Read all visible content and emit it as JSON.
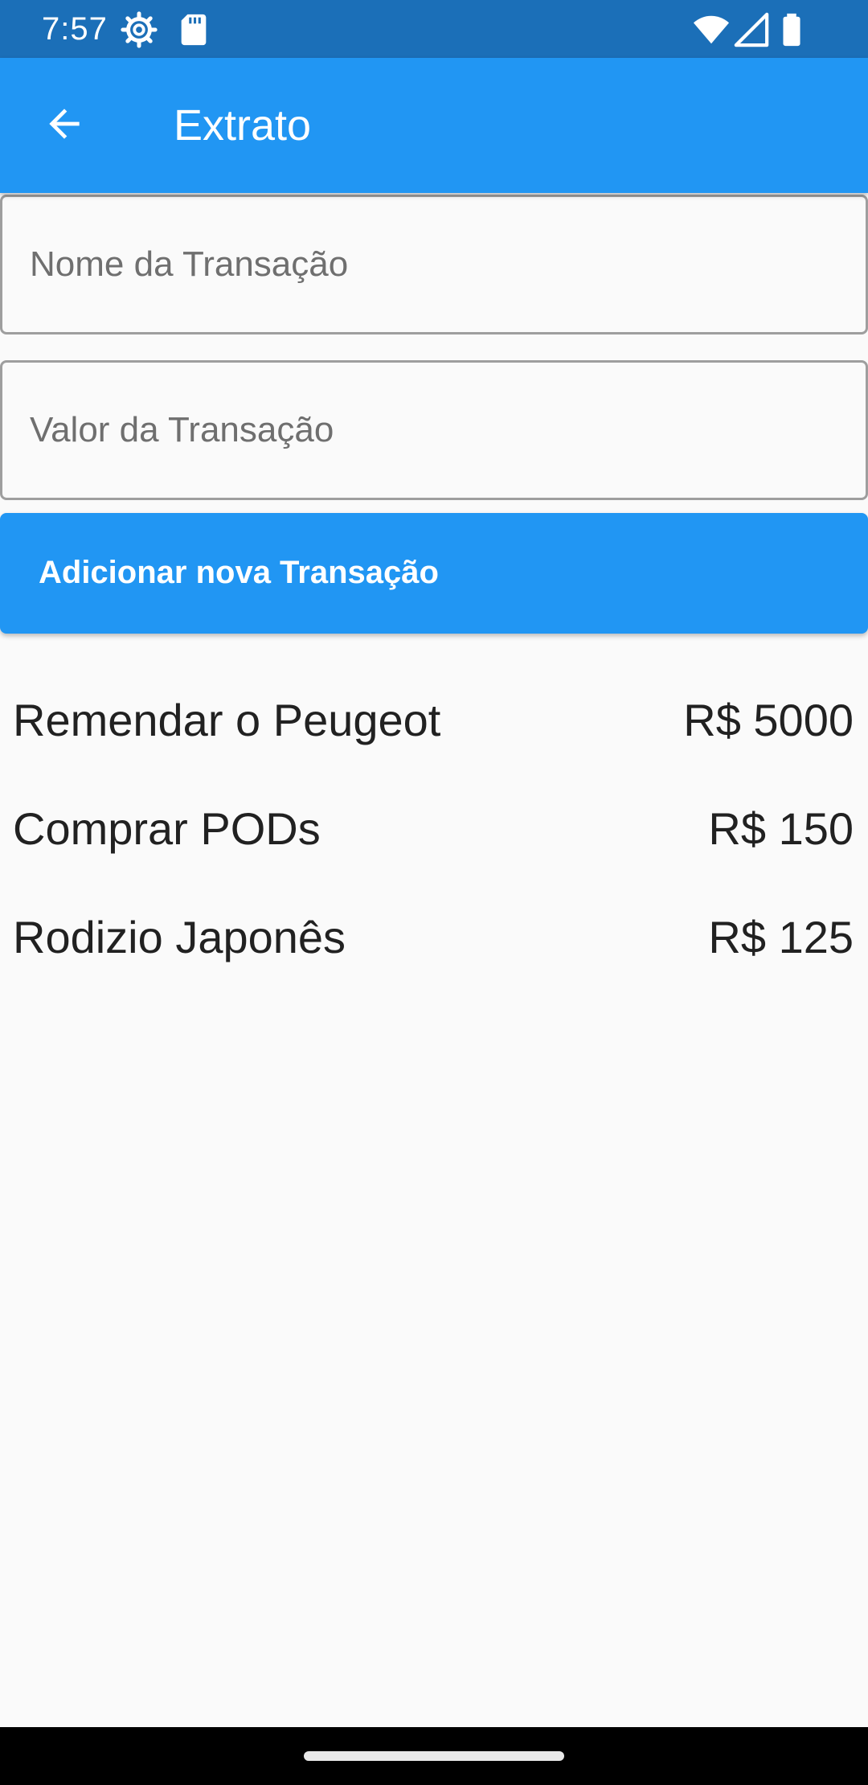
{
  "status_bar": {
    "time": "7:57",
    "icons": [
      "settings-gear-icon",
      "sd-card-icon",
      "wifi-icon",
      "cell-signal-icon",
      "battery-icon"
    ]
  },
  "app_bar": {
    "title": "Extrato",
    "back_icon": "arrow-back-icon",
    "color": "#2196f3"
  },
  "form": {
    "nome": {
      "placeholder": "Nome da Transação",
      "value": ""
    },
    "valor": {
      "placeholder": "Valor da Transação",
      "value": ""
    },
    "add_button_label": "Adicionar nova Transação"
  },
  "transactions": [
    {
      "name": "Remendar o Peugeot",
      "value": "R$ 5000"
    },
    {
      "name": "Comprar PODs",
      "value": "R$ 150"
    },
    {
      "name": "Rodizio Japonês",
      "value": "R$ 125"
    }
  ],
  "colors": {
    "status_bar": "#1b6fb8",
    "primary": "#2196f3",
    "background": "#fafafa",
    "text": "#212121"
  }
}
